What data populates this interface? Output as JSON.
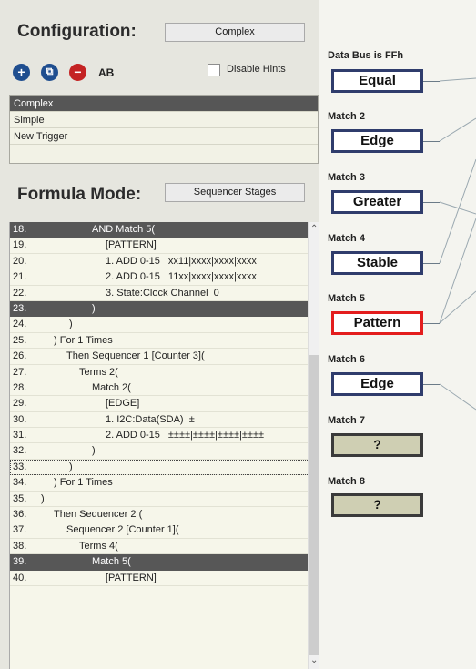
{
  "config": {
    "title": "Configuration:",
    "mode_value": "Complex",
    "ab_label": "AB",
    "disable_hints_label": "Disable Hints",
    "list": [
      "Complex",
      "Simple",
      "New Trigger"
    ]
  },
  "formula": {
    "title": "Formula Mode:",
    "mode_value": "Sequencer Stages",
    "rows": [
      {
        "num": "18.",
        "text": "AND Match 5(",
        "indent": 90
      },
      {
        "num": "19.",
        "text": "[PATTERN]",
        "indent": 105
      },
      {
        "num": "20.",
        "text": "1. ADD 0-15  |xx11|xxxx|xxxx|xxxx",
        "indent": 105
      },
      {
        "num": "21.",
        "text": "2. ADD 0-15  |11xx|xxxx|xxxx|xxxx",
        "indent": 105
      },
      {
        "num": "22.",
        "text": "3. State:Clock Channel  0",
        "indent": 105
      },
      {
        "num": "23.",
        "text": ")",
        "indent": 90
      },
      {
        "num": "24.",
        "text": ")",
        "indent": 65
      },
      {
        "num": "25.",
        "text": ") For 1 Times",
        "indent": 48
      },
      {
        "num": "26.",
        "text": "Then Sequencer 1 [Counter 3](",
        "indent": 62
      },
      {
        "num": "27.",
        "text": "Terms 2(",
        "indent": 76
      },
      {
        "num": "28.",
        "text": "Match 2(",
        "indent": 90
      },
      {
        "num": "29.",
        "text": "[EDGE]",
        "indent": 105
      },
      {
        "num": "30.",
        "text": "1. I2C:Data(SDA)  ±",
        "indent": 105
      },
      {
        "num": "31.",
        "text": "2. ADD 0-15  |±±±±|±±±±|±±±±|±±±±",
        "indent": 105
      },
      {
        "num": "32.",
        "text": ")",
        "indent": 90
      },
      {
        "num": "33.",
        "text": ")",
        "indent": 65
      },
      {
        "num": "34.",
        "text": ") For 1 Times",
        "indent": 48
      },
      {
        "num": "35.",
        "text": ")",
        "indent": 34
      },
      {
        "num": "36.",
        "text": "Then Sequencer 2 (",
        "indent": 48
      },
      {
        "num": "37.",
        "text": "Sequencer 2 [Counter 1](",
        "indent": 62
      },
      {
        "num": "38.",
        "text": "Terms 4(",
        "indent": 76
      },
      {
        "num": "39.",
        "text": "Match 5(",
        "indent": 90
      },
      {
        "num": "40.",
        "text": "[PATTERN]",
        "indent": 105
      }
    ],
    "highlighted_rows": [
      "18.",
      "23.",
      "39."
    ],
    "focused_row": "33."
  },
  "matches": [
    {
      "label": "Data Bus is FFh",
      "value": "Equal",
      "style": "normal"
    },
    {
      "label": "Match 2",
      "value": "Edge",
      "style": "normal"
    },
    {
      "label": "Match 3",
      "value": "Greater",
      "style": "normal"
    },
    {
      "label": "Match 4",
      "value": "Stable",
      "style": "normal"
    },
    {
      "label": "Match 5",
      "value": "Pattern",
      "style": "red"
    },
    {
      "label": "Match 6",
      "value": "Edge",
      "style": "normal"
    },
    {
      "label": "Match 7",
      "value": "?",
      "style": "empty"
    },
    {
      "label": "Match 8",
      "value": "?",
      "style": "empty"
    }
  ],
  "icons": {
    "add": "plus-circle-icon",
    "duplicate": "duplicate-circle-icon",
    "remove": "minus-circle-icon",
    "scroll_up": "scroll-up-arrow-icon",
    "scroll_down": "scroll-down-arrow-icon"
  },
  "colors": {
    "selection": "#565656",
    "match_border": "#2f3c6c",
    "active_border": "#e31d1d",
    "empty_fill": "#cfcfb3"
  }
}
